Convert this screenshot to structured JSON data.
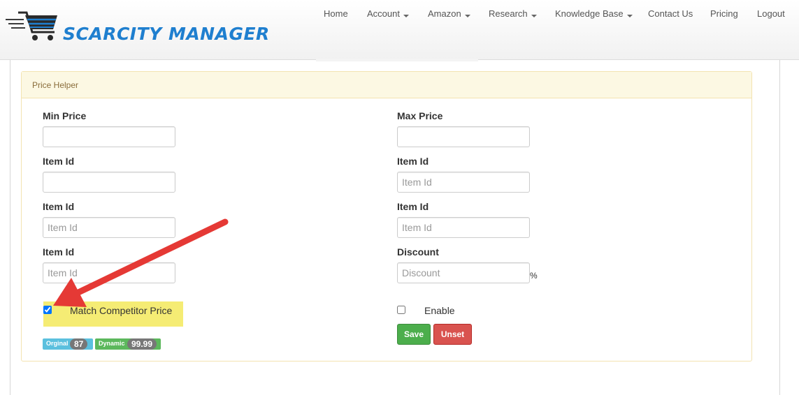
{
  "brand": {
    "name": "SCARCITY MANAGER"
  },
  "nav": {
    "items": [
      {
        "label": "Home",
        "dropdown": false
      },
      {
        "label": "Account",
        "dropdown": true
      },
      {
        "label": "Amazon",
        "dropdown": true
      },
      {
        "label": "Research",
        "dropdown": true
      },
      {
        "label": "Knowledge Base",
        "dropdown": true
      },
      {
        "label": "Contact Us",
        "dropdown": false
      },
      {
        "label": "Pricing",
        "dropdown": false
      },
      {
        "label": "Logout",
        "dropdown": false
      }
    ]
  },
  "panel": {
    "title": "Price Helper",
    "left": {
      "min_price": {
        "label": "Min Price",
        "value": "",
        "placeholder": ""
      },
      "item1": {
        "label": "Item Id",
        "value": "",
        "placeholder": ""
      },
      "item2": {
        "label": "Item Id",
        "value": "",
        "placeholder": "Item Id"
      },
      "item3": {
        "label": "Item Id",
        "value": "",
        "placeholder": "Item Id"
      },
      "match_competitor": {
        "label": "Match Competitor Price",
        "checked": true
      }
    },
    "right": {
      "max_price": {
        "label": "Max Price",
        "value": "",
        "placeholder": ""
      },
      "item4": {
        "label": "Item Id",
        "value": "",
        "placeholder": "Item Id"
      },
      "item5": {
        "label": "Item Id",
        "value": "",
        "placeholder": "Item Id"
      },
      "discount": {
        "label": "Discount",
        "value": "",
        "placeholder": "Discount",
        "suffix": "%"
      },
      "enable": {
        "label": "Enable",
        "checked": false
      }
    },
    "badges": {
      "original_label": "Orginal",
      "original_value": "87",
      "dynamic_label": "Dynamic",
      "dynamic_value": "99.99"
    },
    "buttons": {
      "save": "Save",
      "unset": "Unset"
    }
  },
  "colors": {
    "brand": "#1f7fcf",
    "panel_heading_bg": "#fcf8e3",
    "highlight": "#f5ec74",
    "arrow": "#e53935",
    "save": "#4cae4c",
    "unset": "#d9534f",
    "badge_original": "#5bc0de",
    "badge_dynamic": "#5cb85c"
  },
  "icons": {
    "logo": "shopping-cart-icon",
    "annotation": "red-arrow-icon"
  }
}
